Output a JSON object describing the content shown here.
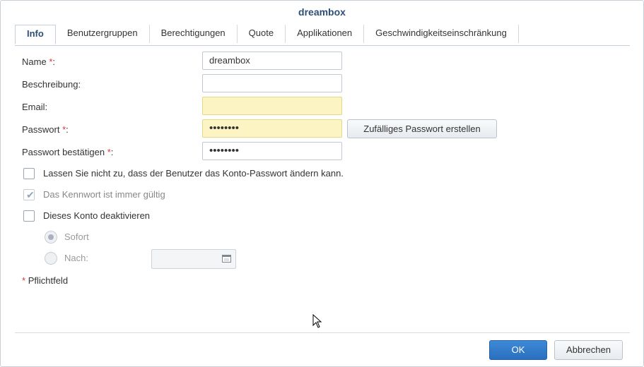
{
  "window": {
    "title": "dreambox"
  },
  "tabs": [
    {
      "label": "Info",
      "active": true
    },
    {
      "label": "Benutzergruppen"
    },
    {
      "label": "Berechtigungen"
    },
    {
      "label": "Quote"
    },
    {
      "label": "Applikationen"
    },
    {
      "label": "Geschwindigkeitseinschränkung"
    }
  ],
  "form": {
    "name_label": "Name",
    "name_value": "dreambox",
    "description_label": "Beschreibung:",
    "description_value": "",
    "email_label": "Email:",
    "email_value": "",
    "password_label": "Passwort",
    "password_value": "••••••••",
    "confirm_label": "Passwort bestätigen",
    "confirm_value": "••••••••",
    "required_marker": "*",
    "random_password_button": "Zufälliges Passwort erstellen"
  },
  "options": {
    "no_pw_change": "Lassen Sie nicht zu, dass der Benutzer das Konto-Passwort ändern kann.",
    "pw_always_valid": "Das Kennwort ist immer gültig",
    "disable_account": "Dieses Konto deaktivieren",
    "immediately": "Sofort",
    "after": "Nach:"
  },
  "required_note": {
    "marker": "*",
    "text": "Pflichtfeld"
  },
  "footer": {
    "ok": "OK",
    "cancel": "Abbrechen"
  },
  "colors": {
    "accent": "#2c4f75",
    "required": "#d9383a",
    "autofill": "#fdf4c3",
    "primary_button": "#2f76c7"
  }
}
